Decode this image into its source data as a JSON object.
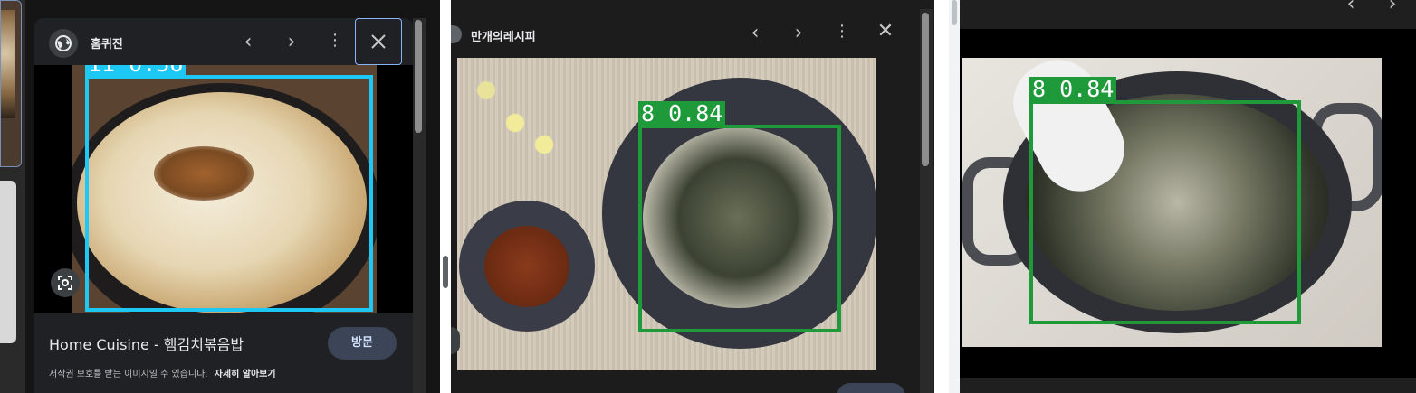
{
  "panel1": {
    "site_name": "홈퀴진",
    "detection_label": "11  0.36",
    "caption_title": "Home Cuisine - 햄김치볶음밥",
    "visit_button": "방문",
    "copyright_notice": "저작권 보호를 받는 이미지일 수 있습니다.",
    "learn_more": "자세히 알아보기"
  },
  "panel2": {
    "site_name": "만개의레시피",
    "detection_label": "8  0.84"
  },
  "panel3": {
    "detection_label": "8  0.84"
  },
  "colors": {
    "bbox_cyan": "#1ec8f5",
    "bbox_green": "#1f9a3a",
    "panel_bg": "#1f1f1f",
    "visit_button_bg": "#3c4457"
  }
}
